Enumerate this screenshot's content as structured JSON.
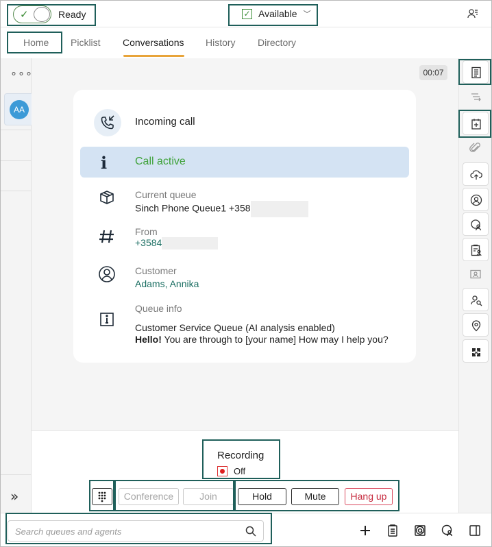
{
  "topbar": {
    "ready_label": "Ready",
    "status_label": "Available"
  },
  "tabs": [
    {
      "label": "Home"
    },
    {
      "label": "Picklist"
    },
    {
      "label": "Conversations"
    },
    {
      "label": "History"
    },
    {
      "label": "Directory"
    }
  ],
  "leftrail": {
    "more_glyph": "∘∘∘",
    "avatar_initials": "AA",
    "collapse_glyph": "»"
  },
  "call": {
    "timer": "00:07",
    "title": "Incoming call",
    "status": "Call active",
    "current_queue_label": "Current queue",
    "current_queue_value": "Sinch Phone Queue1 +358",
    "from_label": "From",
    "from_value": "+3584",
    "customer_label": "Customer",
    "customer_value": "Adams, Annika",
    "queue_info_label": "Queue info",
    "queue_info_line1": "Customer Service Queue (AI analysis enabled)",
    "queue_info_greeting_bold": "Hello!",
    "queue_info_greeting_rest": " You are through to [your name] How may I help you?"
  },
  "recording": {
    "title": "Recording",
    "state": "Off"
  },
  "controls": {
    "conference": "Conference",
    "join": "Join",
    "hold": "Hold",
    "mute": "Mute",
    "hang_up": "Hang up"
  },
  "search": {
    "placeholder": "Search queues and agents"
  },
  "colors": {
    "highlight": "#1f5f5a",
    "active_green": "#3fa23a",
    "link_teal": "#1c6f63",
    "accent_orange": "#e8a43a",
    "danger_red": "#c62a3e"
  }
}
